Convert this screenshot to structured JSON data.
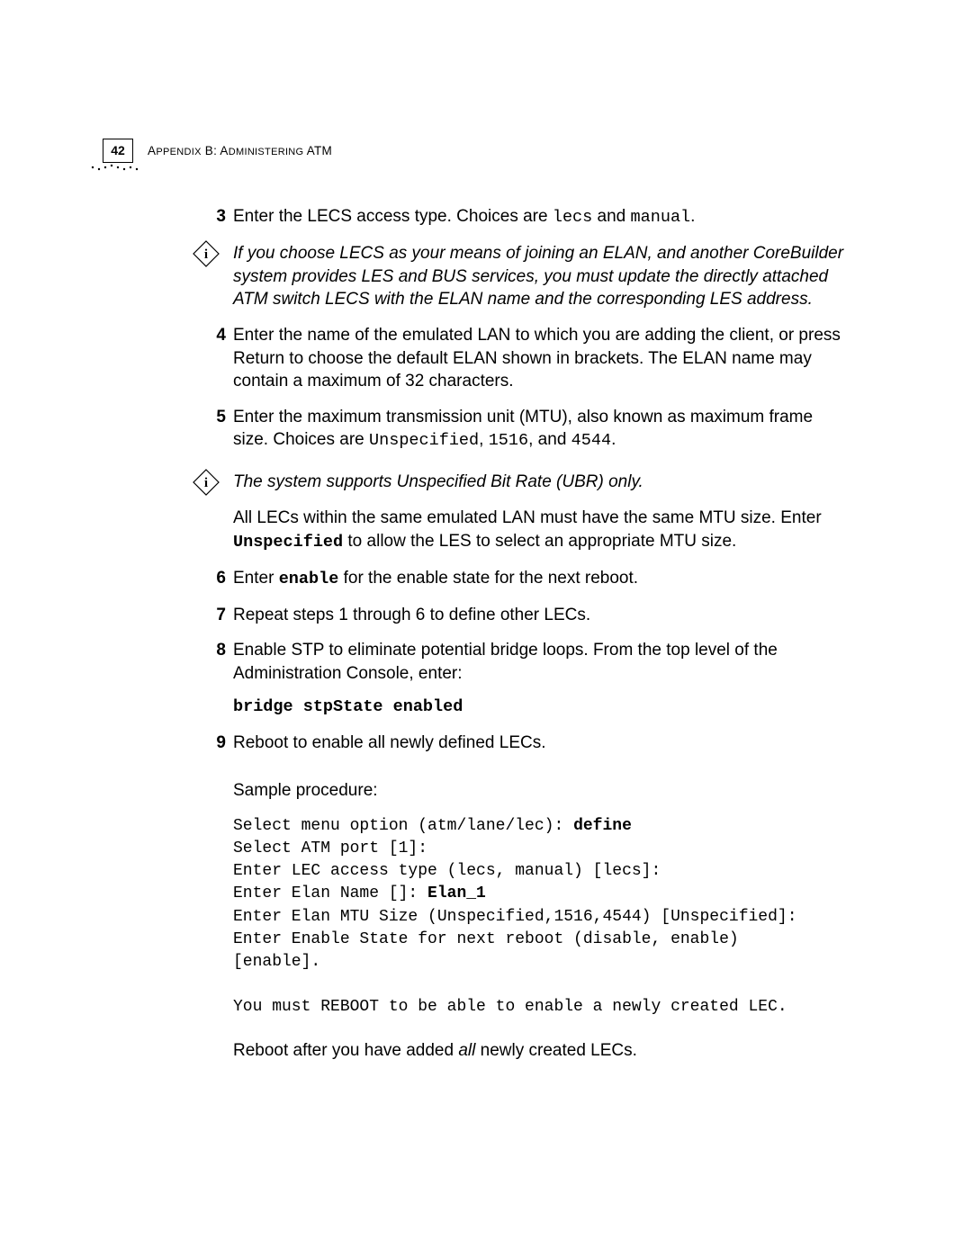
{
  "header": {
    "page_number": "42",
    "appendix_prefix": "A",
    "appendix_word_sc": "PPENDIX",
    "appendix_letter": " B: A",
    "appendix_word2_sc": "DMINISTERING",
    "appendix_suffix": " ATM"
  },
  "step3": {
    "num": "3",
    "t1": "Enter the LECS access type. Choices are ",
    "c1": "lecs",
    "t2": " and ",
    "c2": "manual",
    "t3": "."
  },
  "note1": {
    "text": "If you choose LECS as your means of joining an ELAN, and another CoreBuilder system provides LES and BUS services, you must update the directly attached ATM switch LECS with the ELAN name and the corresponding LES address."
  },
  "step4": {
    "num": "4",
    "text": "Enter the name of the emulated LAN to which you are adding the client, or press Return to choose the default ELAN shown in brackets. The ELAN name may contain a maximum of 32 characters."
  },
  "step5": {
    "num": "5",
    "t1": "Enter the maximum transmission unit (MTU), also known as maximum frame size. Choices are ",
    "c1": "Unspecified",
    "t2": ", ",
    "c2": "1516",
    "t3": ", and ",
    "c3": "4544",
    "t4": "."
  },
  "note2": {
    "text": "The system supports Unspecified Bit Rate (UBR) only."
  },
  "para_mtu": {
    "t1": "All LECs within the same emulated LAN must have the same MTU size. Enter ",
    "c1": "Unspecified",
    "t2": " to allow the LES to select an appropriate MTU size."
  },
  "step6": {
    "num": "6",
    "t1": "Enter ",
    "c1": "enable",
    "t2": " for the enable state for the next reboot."
  },
  "step7": {
    "num": "7",
    "text": "Repeat steps 1 through 6 to define other LECs."
  },
  "step8": {
    "num": "8",
    "text": "Enable STP to eliminate potential bridge loops. From the top level of the Administration Console, enter:",
    "cmd": "bridge stpState enabled"
  },
  "step9": {
    "num": "9",
    "text": "Reboot to enable all newly defined LECs."
  },
  "sample_label": "Sample procedure:",
  "sample": {
    "l1a": "Select menu option (atm/lane/lec): ",
    "l1b": "define",
    "l2": "Select ATM port [1]:",
    "l3": "Enter LEC access type (lecs, manual) [lecs]:",
    "l4a": "Enter Elan Name []: ",
    "l4b": "Elan_1",
    "l5": "Enter Elan MTU Size (Unspecified,1516,4544) [Unspecified]:",
    "l6": "Enter Enable State for next reboot (disable, enable)\n[enable].",
    "l8": "You must REBOOT to be able to enable a newly created LEC."
  },
  "closing": {
    "t1": "Reboot after you have added ",
    "t2": "all",
    "t3": " newly created LECs."
  }
}
